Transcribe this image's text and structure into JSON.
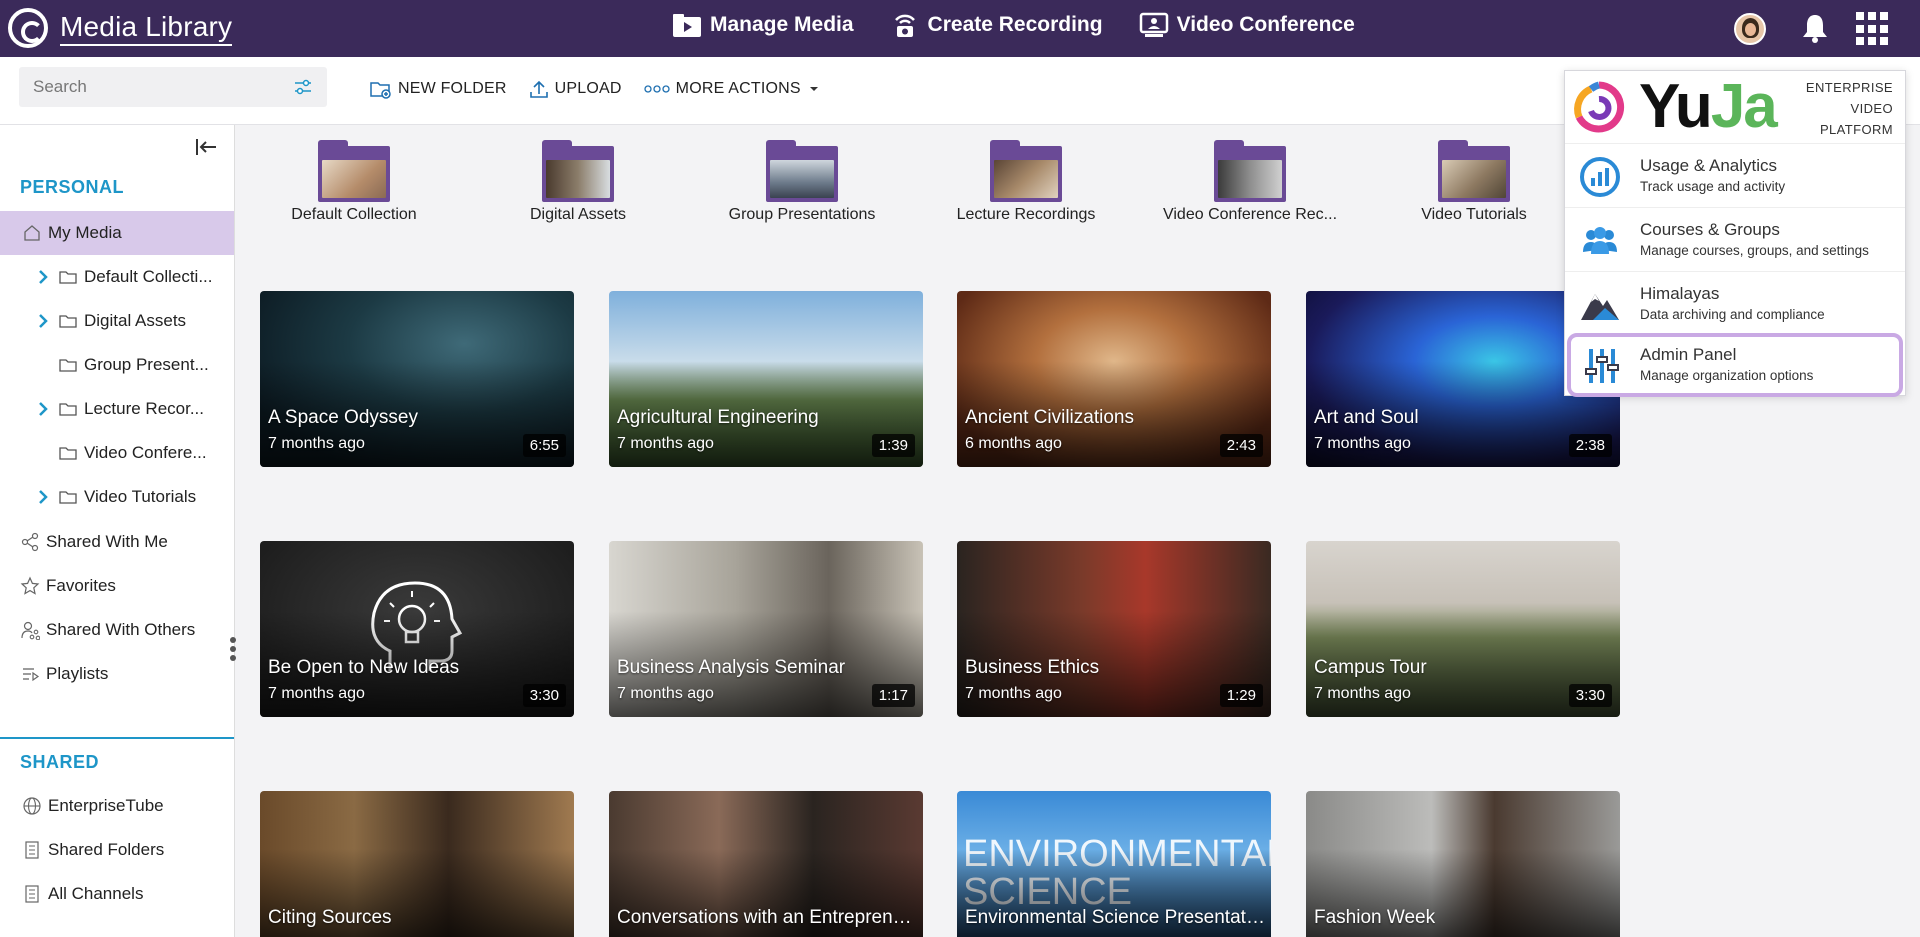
{
  "app": {
    "title": "Media Library"
  },
  "nav": [
    {
      "label": "Manage Media",
      "icon": "play-folder-icon"
    },
    {
      "label": "Create Recording",
      "icon": "broadcast-icon"
    },
    {
      "label": "Video Conference",
      "icon": "monitor-user-icon"
    }
  ],
  "toolbar": {
    "search_placeholder": "Search",
    "new_folder": "NEW FOLDER",
    "upload": "UPLOAD",
    "more_actions": "MORE ACTIONS"
  },
  "sidebar": {
    "personal_label": "PERSONAL",
    "shared_label": "SHARED",
    "personal_items": [
      {
        "label": "My Media",
        "icon": "home-icon"
      },
      {
        "label": "Default Collecti...",
        "icon": "folder-icon",
        "expandable": true
      },
      {
        "label": "Digital Assets",
        "icon": "folder-icon",
        "expandable": true
      },
      {
        "label": "Group Present...",
        "icon": "folder-icon",
        "expandable": false
      },
      {
        "label": "Lecture Recor...",
        "icon": "folder-icon",
        "expandable": true
      },
      {
        "label": "Video Confere...",
        "icon": "folder-icon",
        "expandable": false
      },
      {
        "label": "Video Tutorials",
        "icon": "folder-icon",
        "expandable": true
      },
      {
        "label": "Shared With Me",
        "icon": "share-icon"
      },
      {
        "label": "Favorites",
        "icon": "star-icon"
      },
      {
        "label": "Shared With Others",
        "icon": "user-share-icon"
      },
      {
        "label": "Playlists",
        "icon": "playlist-icon"
      }
    ],
    "shared_items": [
      {
        "label": "EnterpriseTube",
        "icon": "globe-icon"
      },
      {
        "label": "Shared Folders",
        "icon": "building-icon"
      },
      {
        "label": "All Channels",
        "icon": "building-icon"
      }
    ]
  },
  "folders": [
    {
      "label": "Default Collection"
    },
    {
      "label": "Digital Assets"
    },
    {
      "label": "Group Presentations"
    },
    {
      "label": "Lecture Recordings"
    },
    {
      "label": "Video Conference Rec..."
    },
    {
      "label": "Video Tutorials"
    }
  ],
  "videos": [
    {
      "title": "A Space Odyssey",
      "age": "7 months ago",
      "duration": "6:55"
    },
    {
      "title": "Agricultural Engineering",
      "age": "7 months ago",
      "duration": "1:39"
    },
    {
      "title": "Ancient Civilizations",
      "age": "6 months ago",
      "duration": "2:43"
    },
    {
      "title": "Art and Soul",
      "age": "7 months ago",
      "duration": "2:38"
    },
    {
      "title": "Be Open to New Ideas",
      "age": "7 months ago",
      "duration": "3:30"
    },
    {
      "title": "Business Analysis Seminar",
      "age": "7 months ago",
      "duration": "1:17"
    },
    {
      "title": "Business Ethics",
      "age": "7 months ago",
      "duration": "1:29"
    },
    {
      "title": "Campus Tour",
      "age": "7 months ago",
      "duration": "3:30"
    },
    {
      "title": "Citing Sources",
      "age": "",
      "duration": ""
    },
    {
      "title": "Conversations with an Entrepreneur",
      "age": "",
      "duration": ""
    },
    {
      "title": "Environmental Science Presentation",
      "age": "",
      "duration": ""
    },
    {
      "title": "Fashion Week",
      "age": "",
      "duration": ""
    }
  ],
  "env_overlay_text": "ENVIRONMENTAL SCIENCE",
  "panel": {
    "logo_yu": "Yu",
    "logo_ja": "Ja",
    "tagline": [
      "ENTERPRISE",
      "VIDEO",
      "PLATFORM"
    ],
    "items": [
      {
        "title": "Usage & Analytics",
        "subtitle": "Track usage and activity",
        "icon": "analytics-icon"
      },
      {
        "title": "Courses & Groups",
        "subtitle": "Manage courses, groups, and settings",
        "icon": "users-group-icon"
      },
      {
        "title": "Himalayas",
        "subtitle": "Data archiving and compliance",
        "icon": "mountain-icon"
      },
      {
        "title": "Admin Panel",
        "subtitle": "Manage organization options",
        "icon": "sliders-icon"
      }
    ]
  },
  "colors": {
    "topbar": "#3b2a5a",
    "accent": "#1e96c8",
    "active": "#d8c9ea",
    "folder": "#6a4a96",
    "highlight": "#c9a9e4"
  }
}
